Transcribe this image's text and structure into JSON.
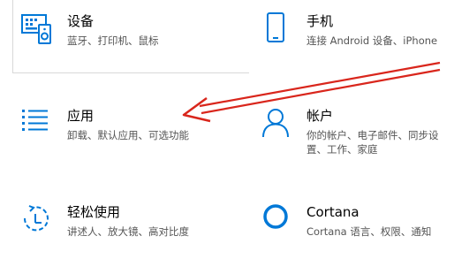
{
  "tiles": {
    "devices": {
      "title": "设备",
      "desc": "蓝牙、打印机、鼠标",
      "icon": "keyboard-icon"
    },
    "phone": {
      "title": "手机",
      "desc": "连接 Android 设备、iPhone",
      "icon": "phone-icon"
    },
    "apps": {
      "title": "应用",
      "desc": "卸载、默认应用、可选功能",
      "icon": "app-list-icon"
    },
    "accounts": {
      "title": "帐户",
      "desc": "你的帐户、电子邮件、同步设",
      "desc2": "置、工作、家庭",
      "icon": "person-icon"
    },
    "ease": {
      "title": "轻松使用",
      "desc": "讲述人、放大镜、高对比度",
      "icon": "ease-of-access-icon"
    },
    "cortana": {
      "title": "Cortana",
      "desc": "Cortana 语言、权限、通知",
      "icon": "cortana-icon"
    }
  },
  "colors": {
    "icon": "#0078d7",
    "annotation_arrow": "#d9261c"
  }
}
